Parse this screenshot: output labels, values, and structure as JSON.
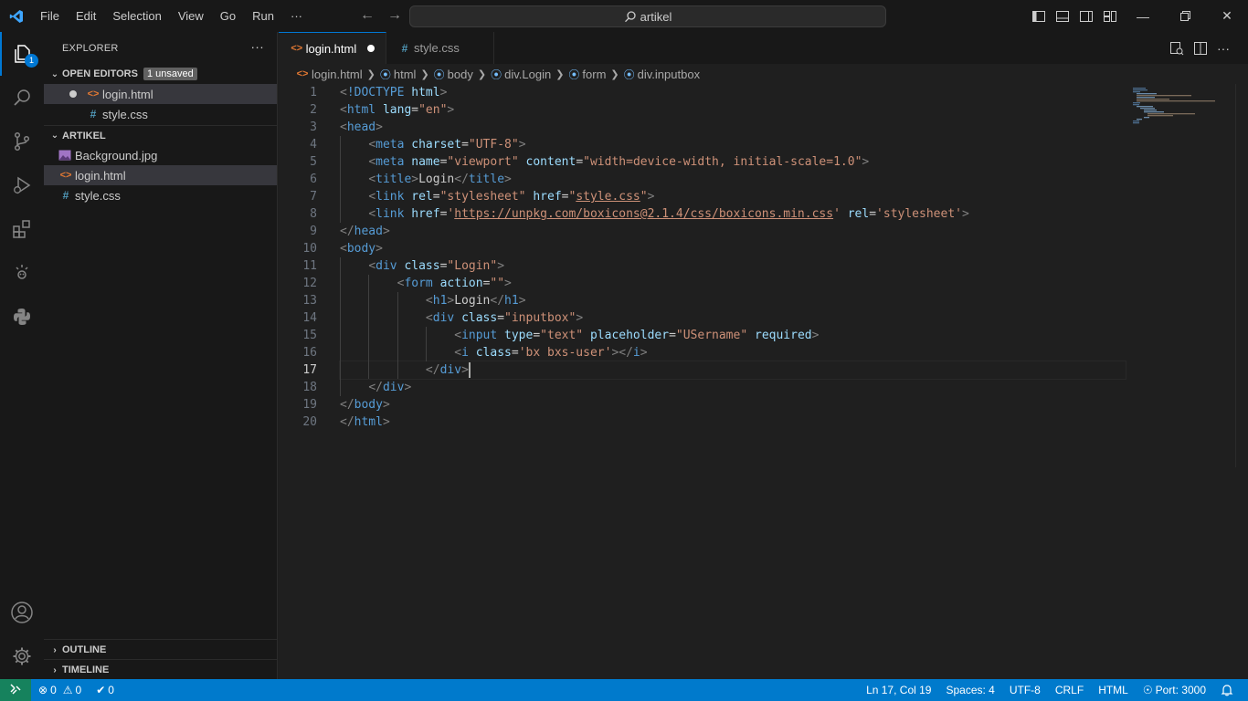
{
  "menu": [
    "File",
    "Edit",
    "Selection",
    "View",
    "Go",
    "Run",
    "···"
  ],
  "command_center": {
    "label": "artikel",
    "icon": "search-icon"
  },
  "title_actions": [
    "toggle-primary-sidebar-icon",
    "toggle-panel-icon",
    "toggle-secondary-sidebar-icon",
    "customize-layout-icon"
  ],
  "window_controls": [
    "minimize",
    "restore",
    "close"
  ],
  "activity_bar": {
    "items": [
      "explorer-icon",
      "search-icon",
      "source-control-icon",
      "run-debug-icon",
      "extensions-icon",
      "live-share-icon",
      "python-icon"
    ],
    "explorer_badge": "1",
    "bottom": [
      "accounts-icon",
      "manage-gear-icon"
    ]
  },
  "sidebar": {
    "title": "EXPLORER",
    "more": "···",
    "open_editors": {
      "label": "OPEN EDITORS",
      "badge": "1 unsaved",
      "files": [
        {
          "name": "login.html",
          "type": "html",
          "unsaved": true
        },
        {
          "name": "style.css",
          "type": "css",
          "unsaved": false
        }
      ]
    },
    "folder": {
      "label": "ARTIKEL",
      "files": [
        {
          "name": "Background.jpg",
          "type": "image"
        },
        {
          "name": "login.html",
          "type": "html"
        },
        {
          "name": "style.css",
          "type": "css"
        }
      ]
    },
    "outline_label": "OUTLINE",
    "timeline_label": "TIMELINE"
  },
  "tabs": [
    {
      "label": "login.html",
      "icon": "<>",
      "active": true,
      "dirty": true
    },
    {
      "label": "style.css",
      "icon": "#",
      "active": false,
      "dirty": false
    }
  ],
  "breadcrumb": {
    "file": "login.html",
    "items": [
      "html",
      "body",
      "div.Login",
      "form",
      "div.inputbox"
    ]
  },
  "editor": {
    "current_line": 17,
    "lines": [
      [
        [
          "br",
          "<"
        ],
        [
          "tag",
          "!DOCTYPE"
        ],
        [
          "txt",
          " "
        ],
        [
          "attr",
          "html"
        ],
        [
          "br",
          ">"
        ]
      ],
      [
        [
          "br",
          "<"
        ],
        [
          "tag",
          "html"
        ],
        [
          "txt",
          " "
        ],
        [
          "attr",
          "lang"
        ],
        [
          "txt",
          "="
        ],
        [
          "str",
          "\"en\""
        ],
        [
          "br",
          ">"
        ]
      ],
      [
        [
          "br",
          "<"
        ],
        [
          "tag",
          "head"
        ],
        [
          "br",
          ">"
        ]
      ],
      [
        [
          "txt",
          "    "
        ],
        [
          "br",
          "<"
        ],
        [
          "tag",
          "meta"
        ],
        [
          "txt",
          " "
        ],
        [
          "attr",
          "charset"
        ],
        [
          "txt",
          "="
        ],
        [
          "str",
          "\"UTF-8\""
        ],
        [
          "br",
          ">"
        ]
      ],
      [
        [
          "txt",
          "    "
        ],
        [
          "br",
          "<"
        ],
        [
          "tag",
          "meta"
        ],
        [
          "txt",
          " "
        ],
        [
          "attr",
          "name"
        ],
        [
          "txt",
          "="
        ],
        [
          "str",
          "\"viewport\""
        ],
        [
          "txt",
          " "
        ],
        [
          "attr",
          "content"
        ],
        [
          "txt",
          "="
        ],
        [
          "str",
          "\"width=device-width, initial-scale=1.0\""
        ],
        [
          "br",
          ">"
        ]
      ],
      [
        [
          "txt",
          "    "
        ],
        [
          "br",
          "<"
        ],
        [
          "tag",
          "title"
        ],
        [
          "br",
          ">"
        ],
        [
          "txt",
          "Login"
        ],
        [
          "br",
          "</"
        ],
        [
          "tag",
          "title"
        ],
        [
          "br",
          ">"
        ]
      ],
      [
        [
          "txt",
          "    "
        ],
        [
          "br",
          "<"
        ],
        [
          "tag",
          "link"
        ],
        [
          "txt",
          " "
        ],
        [
          "attr",
          "rel"
        ],
        [
          "txt",
          "="
        ],
        [
          "str",
          "\"stylesheet\""
        ],
        [
          "txt",
          " "
        ],
        [
          "attr",
          "href"
        ],
        [
          "txt",
          "="
        ],
        [
          "str",
          "\""
        ],
        [
          "link",
          "style.css"
        ],
        [
          "str",
          "\""
        ],
        [
          "br",
          ">"
        ]
      ],
      [
        [
          "txt",
          "    "
        ],
        [
          "br",
          "<"
        ],
        [
          "tag",
          "link"
        ],
        [
          "txt",
          " "
        ],
        [
          "attr",
          "href"
        ],
        [
          "txt",
          "="
        ],
        [
          "str",
          "'"
        ],
        [
          "link",
          "https://unpkg.com/boxicons@2.1.4/css/boxicons.min.css"
        ],
        [
          "str",
          "'"
        ],
        [
          "txt",
          " "
        ],
        [
          "attr",
          "rel"
        ],
        [
          "txt",
          "="
        ],
        [
          "str",
          "'stylesheet'"
        ],
        [
          "br",
          ">"
        ]
      ],
      [
        [
          "br",
          "</"
        ],
        [
          "tag",
          "head"
        ],
        [
          "br",
          ">"
        ]
      ],
      [
        [
          "br",
          "<"
        ],
        [
          "tag",
          "body"
        ],
        [
          "br",
          ">"
        ]
      ],
      [
        [
          "txt",
          "    "
        ],
        [
          "br",
          "<"
        ],
        [
          "tag",
          "div"
        ],
        [
          "txt",
          " "
        ],
        [
          "attr",
          "class"
        ],
        [
          "txt",
          "="
        ],
        [
          "str",
          "\"Login\""
        ],
        [
          "br",
          ">"
        ]
      ],
      [
        [
          "txt",
          "        "
        ],
        [
          "br",
          "<"
        ],
        [
          "tag",
          "form"
        ],
        [
          "txt",
          " "
        ],
        [
          "attr",
          "action"
        ],
        [
          "txt",
          "="
        ],
        [
          "str",
          "\"\""
        ],
        [
          "br",
          ">"
        ]
      ],
      [
        [
          "txt",
          "            "
        ],
        [
          "br",
          "<"
        ],
        [
          "tag",
          "h1"
        ],
        [
          "br",
          ">"
        ],
        [
          "txt",
          "Login"
        ],
        [
          "br",
          "</"
        ],
        [
          "tag",
          "h1"
        ],
        [
          "br",
          ">"
        ]
      ],
      [
        [
          "txt",
          "            "
        ],
        [
          "br",
          "<"
        ],
        [
          "tag",
          "div"
        ],
        [
          "txt",
          " "
        ],
        [
          "attr",
          "class"
        ],
        [
          "txt",
          "="
        ],
        [
          "str",
          "\"inputbox\""
        ],
        [
          "br",
          ">"
        ]
      ],
      [
        [
          "txt",
          "                "
        ],
        [
          "br",
          "<"
        ],
        [
          "tag",
          "input"
        ],
        [
          "txt",
          " "
        ],
        [
          "attr",
          "type"
        ],
        [
          "txt",
          "="
        ],
        [
          "str",
          "\"text\""
        ],
        [
          "txt",
          " "
        ],
        [
          "attr",
          "placeholder"
        ],
        [
          "txt",
          "="
        ],
        [
          "str",
          "\"USername\""
        ],
        [
          "txt",
          " "
        ],
        [
          "attr",
          "required"
        ],
        [
          "br",
          ">"
        ]
      ],
      [
        [
          "txt",
          "                "
        ],
        [
          "br",
          "<"
        ],
        [
          "tag",
          "i"
        ],
        [
          "txt",
          " "
        ],
        [
          "attr",
          "class"
        ],
        [
          "txt",
          "="
        ],
        [
          "str",
          "'bx bxs-user'"
        ],
        [
          "br",
          "></"
        ],
        [
          "tag",
          "i"
        ],
        [
          "br",
          ">"
        ]
      ],
      [
        [
          "txt",
          "            "
        ],
        [
          "br",
          "</"
        ],
        [
          "tag",
          "div"
        ],
        [
          "br",
          ">"
        ]
      ],
      [
        [
          "txt",
          "    "
        ],
        [
          "br",
          "</"
        ],
        [
          "tag",
          "div"
        ],
        [
          "br",
          ">"
        ]
      ],
      [
        [
          "br",
          "</"
        ],
        [
          "tag",
          "body"
        ],
        [
          "br",
          ">"
        ]
      ],
      [
        [
          "br",
          "</"
        ],
        [
          "tag",
          "html"
        ],
        [
          "br",
          ">"
        ]
      ]
    ]
  },
  "statusbar": {
    "errors": "0",
    "warnings": "0",
    "ports": "0",
    "position": "Ln 17, Col 19",
    "spaces": "Spaces: 4",
    "encoding": "UTF-8",
    "eol": "CRLF",
    "language": "HTML",
    "live_server": "Port: 3000"
  },
  "colors": {
    "accent": "#0078d4",
    "statusbar": "#007acc",
    "html_icon": "#e37933",
    "css_icon": "#519aba",
    "tag": "#569cd6",
    "attribute": "#9cdcfe",
    "string": "#ce9178"
  }
}
